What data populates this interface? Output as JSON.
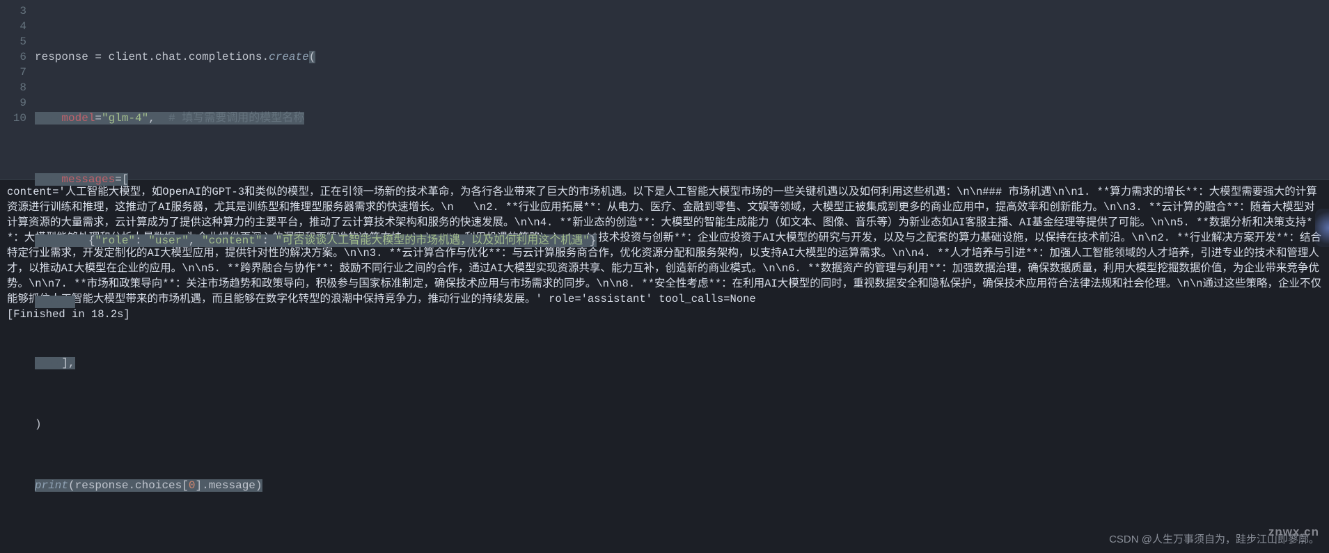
{
  "editor": {
    "gutter": [
      "3",
      "4",
      "5",
      "6",
      "7",
      "8",
      "9",
      "10"
    ],
    "lines": {
      "l3": {
        "t1": "response ",
        "t2": "=",
        "t3": " client",
        "t4": ".",
        "t5": "chat",
        "t6": ".",
        "t7": "completions",
        "t8": ".",
        "t9": "create",
        "t10": "("
      },
      "l4": {
        "dots": "····",
        "t1": "model",
        "t2": "=",
        "t3": "\"glm-4\"",
        "t4": ",  ",
        "t5": "# 填写需要调用的模型名称"
      },
      "l5": {
        "dots": "····",
        "t1": "messages",
        "t2": "=",
        "t3": "["
      },
      "l6": {
        "dots": "········",
        "t1": "{",
        "t2": "\"role\"",
        "t3": ": ",
        "t4": "\"user\"",
        "t5": ", ",
        "t6": "\"content\"",
        "t7": ": ",
        "t8": "\"可否谈谈人工智能大模型的市场机遇，以及如何利用这个机遇\"",
        "t9": "}"
      },
      "l7": {
        "dots": "····"
      },
      "l8": {
        "dots": "····",
        "t1": "],"
      },
      "l9": {
        "t1": ")"
      },
      "l10": {
        "t1": "print",
        "t2": "(response",
        "t3": ".",
        "t4": "choices[",
        "t5": "0",
        "t6": "]",
        "t7": ".",
        "t8": "message)"
      }
    }
  },
  "output": {
    "text": "content='人工智能大模型，如OpenAI的GPT-3和类似的模型，正在引领一场新的技术革命，为各行各业带来了巨大的市场机遇。以下是人工智能大模型市场的一些关键机遇以及如何利用这些机遇：\\n\\n### 市场机遇\\n\\n1. **算力需求的增长**：大模型需要强大的计算资源进行训练和推理，这推动了AI服务器，尤其是训练型和推理型服务器需求的快速增长。\\n   \\n2. **行业应用拓展**：从电力、医疗、金融到零售、文娱等领域，大模型正被集成到更多的商业应用中，提高效率和创新能力。\\n\\n3. **云计算的融合**：随着大模型对计算资源的大量需求，云计算成为了提供这种算力的主要平台，推动了云计算技术架构和服务的快速发展。\\n\\n4. **新业态的创造**：大模型的智能生成能力（如文本、图像、音乐等）为新业态如AI客服主播、AI基金经理等提供了可能。\\n\\n5. **数据分析和决策支持**：大模型能够处理和分析大量数据，为企业提供更深入的洞察和更精准的决策支持。\\n\\n### 利用机遇的策略\\n\\n1. **技术投资与创新**：企业应投资于AI大模型的研究与开发，以及与之配套的算力基础设施，以保持在技术前沿。\\n\\n2. **行业解决方案开发**：结合特定行业需求，开发定制化的AI大模型应用，提供针对性的解决方案。\\n\\n3. **云计算合作与优化**：与云计算服务商合作，优化资源分配和服务架构，以支持AI大模型的运算需求。\\n\\n4. **人才培养与引进**：加强人工智能领域的人才培养，引进专业的技术和管理人才，以推动AI大模型在企业的应用。\\n\\n5. **跨界融合与协作**：鼓励不同行业之间的合作，通过AI大模型实现资源共享、能力互补，创造新的商业模式。\\n\\n6. **数据资产的管理与利用**：加强数据治理，确保数据质量，利用大模型挖掘数据价值，为企业带来竞争优势。\\n\\n7. **市场和政策导向**：关注市场趋势和政策导向，积极参与国家标准制定，确保技术应用与市场需求的同步。\\n\\n8. **安全性考虑**：在利用AI大模型的同时，重视数据安全和隐私保护，确保技术应用符合法律法规和社会伦理。\\n\\n通过这些策略，企业不仅能够抓住人工智能大模型带来的市场机遇，而且能够在数字化转型的浪潮中保持竞争力，推动行业的持续发展。' role='assistant' tool_calls=None",
    "finished": "[Finished in 18.2s]"
  },
  "watermark": {
    "brand": "znwx.cn",
    "credit": "CSDN @人生万事须自为，跬步江山即寥廓。"
  }
}
